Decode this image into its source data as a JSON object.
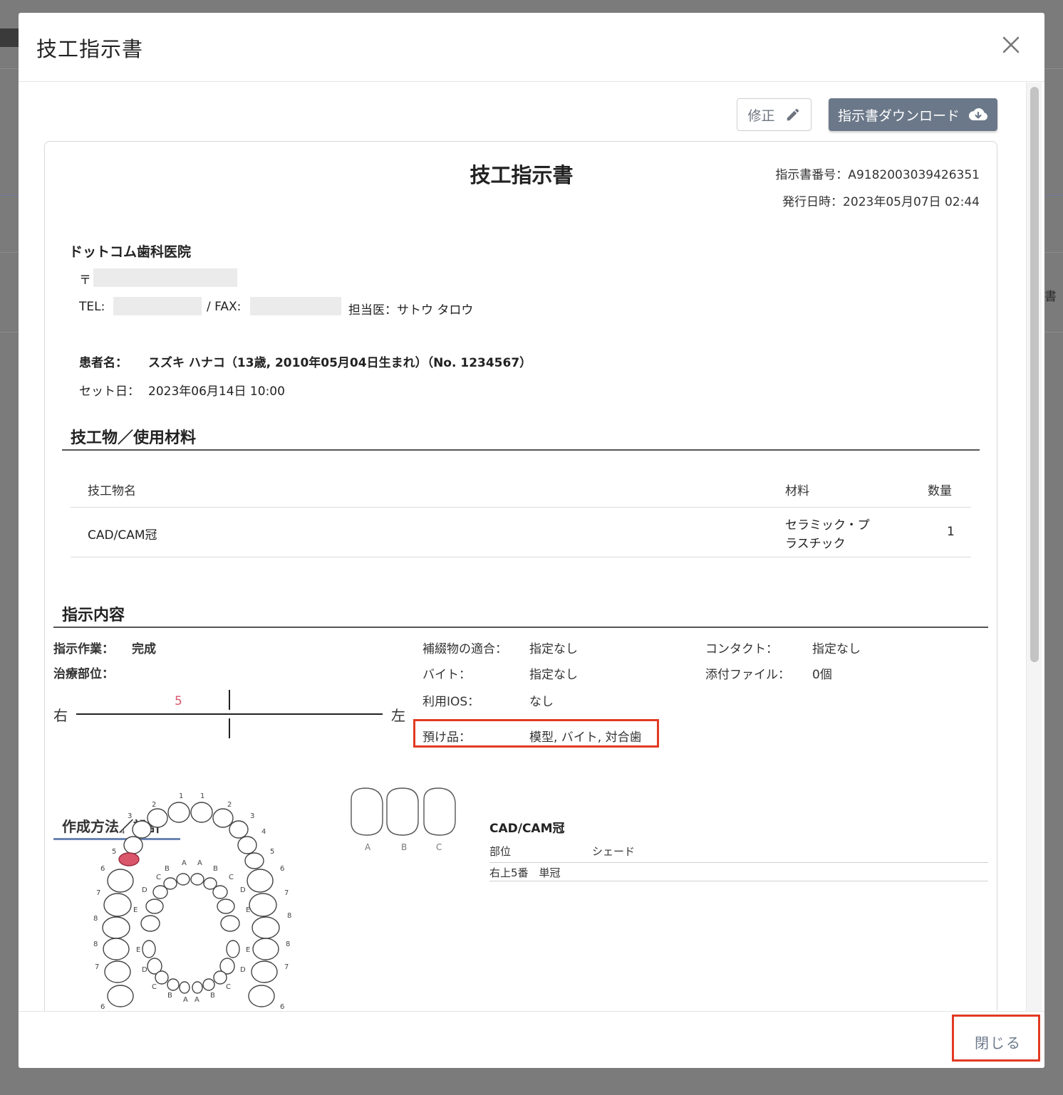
{
  "modal": {
    "title": "技工指示書",
    "edit_label": "修正",
    "download_label": "指示書ダウンロード",
    "close_label": "閉じる"
  },
  "background": {
    "side_text": "書"
  },
  "document": {
    "title": "技工指示書",
    "number": "指示書番号：A9182003039426351",
    "issued": "発行日時：2023年05月07日 02:44",
    "clinic": {
      "name": "ドットコム歯科医院",
      "postal_prefix": "〒",
      "tel_label": "TEL:",
      "fax_label": "/ FAX:",
      "doctor": "担当医：サトウ タロウ"
    },
    "patient": {
      "label": "患者名：",
      "value": "スズキ ハナコ（13歳, 2010年05月04日生まれ）（No. 1234567）"
    },
    "set_date": {
      "label": "セット日：",
      "value": "2023年06月14日 10:00"
    },
    "materials_section": {
      "title": "技工物／使用材料",
      "headers": [
        "技工物名",
        "材料",
        "数量"
      ],
      "rows": [
        {
          "name": "CAD/CAM冠",
          "material_line1": "セラミック・プ",
          "material_line2": "ラスチック",
          "qty": "1"
        }
      ]
    },
    "instructions": {
      "title": "指示内容",
      "work_label": "指示作業：",
      "work_value": "完成",
      "site_label": "治療部位：",
      "right": "右",
      "left": "左",
      "tooth_marked": "5",
      "fit_label": "補綴物の適合：",
      "fit_value": "指定なし",
      "bite_label": "バイト：",
      "bite_value": "指定なし",
      "ios_label": "利用IOS：",
      "ios_value": "なし",
      "deposit_label": "預け品：",
      "deposit_value": "模型, バイト, 対合歯",
      "contact_label": "コンタクト：",
      "contact_value": "指定なし",
      "attach_label": "添付ファイル：",
      "attach_value": "0個"
    },
    "design": {
      "title": "作成方法／設計",
      "shade_labels": [
        "A",
        "B",
        "C"
      ],
      "cad_title": "CAD/CAM冠",
      "headers": [
        "部位",
        "シェード"
      ],
      "rows": [
        {
          "site": "右上5番　単冠",
          "shade": ""
        }
      ]
    }
  },
  "colors": {
    "accent": "#6b7889",
    "highlight": "#e23a22",
    "tooth_selected": "#d9566b"
  }
}
